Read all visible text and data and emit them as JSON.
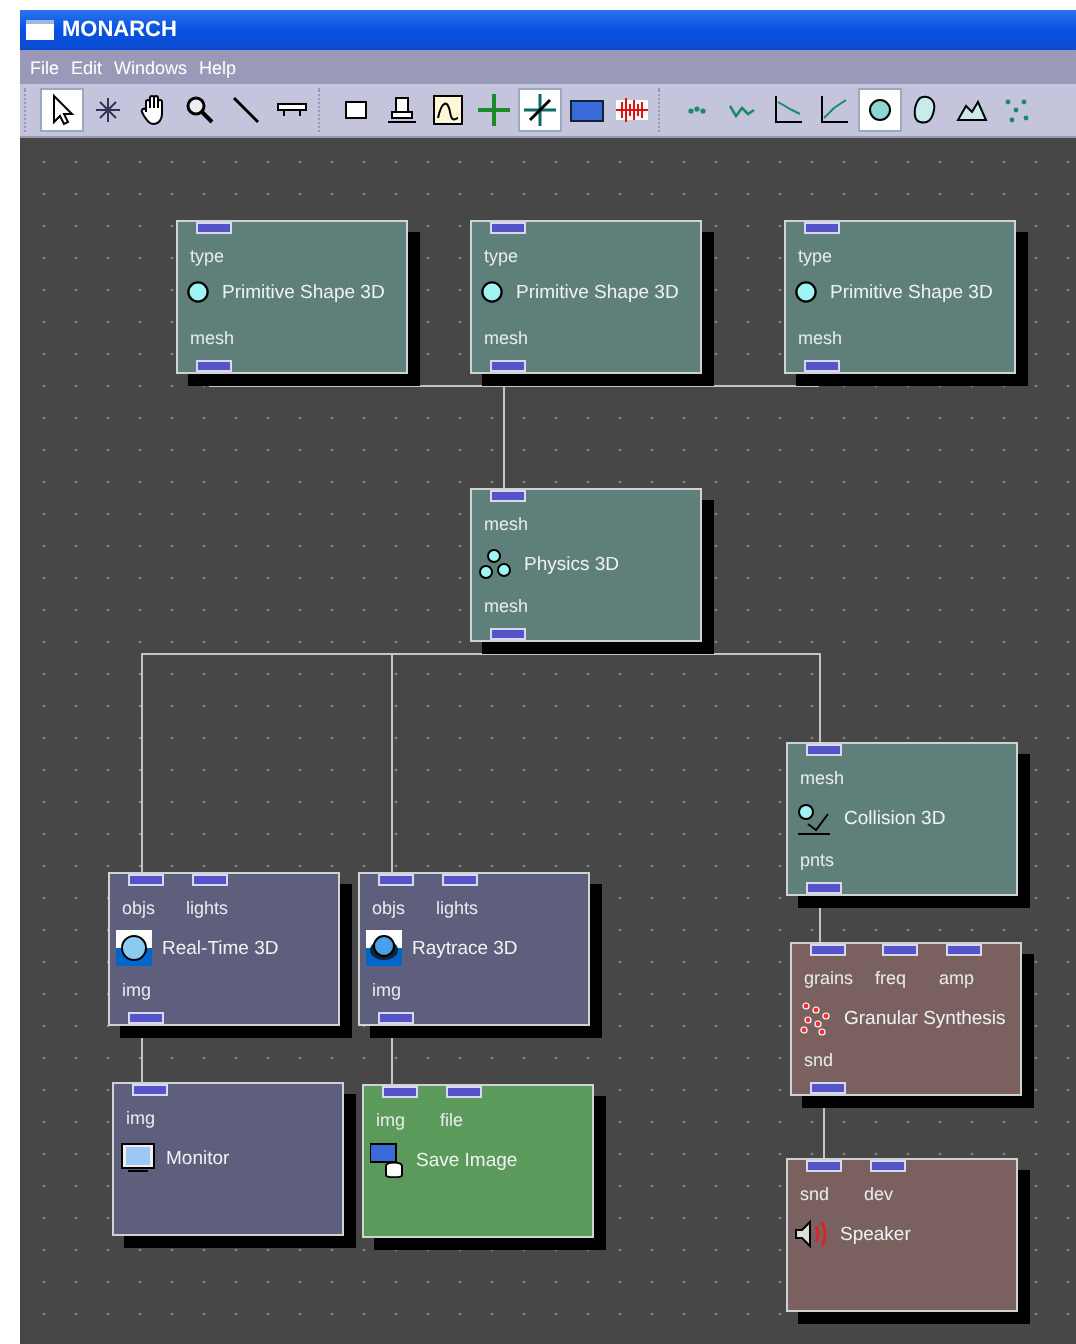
{
  "window": {
    "title": "MONARCH"
  },
  "menu": [
    "File",
    "Edit",
    "Windows",
    "Help"
  ],
  "toolbar": [
    [
      {
        "selected": true
      },
      {
        "selected": false
      },
      {
        "selected": false
      },
      {
        "selected": false
      },
      {
        "selected": false
      },
      {
        "selected": false
      }
    ],
    [
      {
        "selected": false
      },
      {
        "selected": false
      },
      {
        "selected": false
      },
      {
        "selected": false
      },
      {
        "selected": true
      },
      {
        "selected": false
      },
      {
        "selected": false
      }
    ],
    [
      {
        "selected": false
      },
      {
        "selected": false
      },
      {
        "selected": false
      },
      {
        "selected": false
      },
      {
        "selected": true
      },
      {
        "selected": false
      },
      {
        "selected": false
      },
      {
        "selected": false
      }
    ]
  ],
  "nodes": [
    {
      "kind": "primitive",
      "title": "Primitive Shape 3D",
      "color": "#5f7f7b",
      "inputs": [
        "type"
      ],
      "outputs": [
        "mesh"
      ]
    },
    {
      "kind": "primitive",
      "title": "Primitive Shape 3D",
      "color": "#5f7f7b",
      "inputs": [
        "type"
      ],
      "outputs": [
        "mesh"
      ]
    },
    {
      "kind": "primitive",
      "title": "Primitive Shape 3D",
      "color": "#5f7f7b",
      "inputs": [
        "type"
      ],
      "outputs": [
        "mesh"
      ]
    },
    {
      "kind": "physics",
      "title": "Physics 3D",
      "color": "#5f7f7b",
      "inputs": [
        "mesh"
      ],
      "outputs": [
        "mesh"
      ]
    },
    {
      "kind": "collision",
      "title": "Collision 3D",
      "color": "#5f7f7b",
      "inputs": [
        "mesh"
      ],
      "outputs": [
        "pnts"
      ]
    },
    {
      "kind": "realtime",
      "title": "Real-Time 3D",
      "color": "#5d5f7d",
      "inputs": [
        "objs",
        "lights"
      ],
      "outputs": [
        "img"
      ]
    },
    {
      "kind": "raytrace",
      "title": "Raytrace 3D",
      "color": "#5d5f7d",
      "inputs": [
        "objs",
        "lights"
      ],
      "outputs": [
        "img"
      ]
    },
    {
      "kind": "monitor",
      "title": "Monitor",
      "color": "#5d5f7d",
      "inputs": [
        "img"
      ]
    },
    {
      "kind": "save",
      "title": "Save Image",
      "color": "#5c9a5c",
      "inputs": [
        "img",
        "file"
      ]
    },
    {
      "kind": "granular",
      "title": "Granular Synthesis",
      "color": "#7b6060",
      "inputs": [
        "grains",
        "freq",
        "amp"
      ],
      "outputs": [
        "snd"
      ]
    },
    {
      "kind": "speaker",
      "title": "Speaker",
      "color": "#7b6060",
      "inputs": [
        "snd",
        "dev"
      ]
    }
  ]
}
